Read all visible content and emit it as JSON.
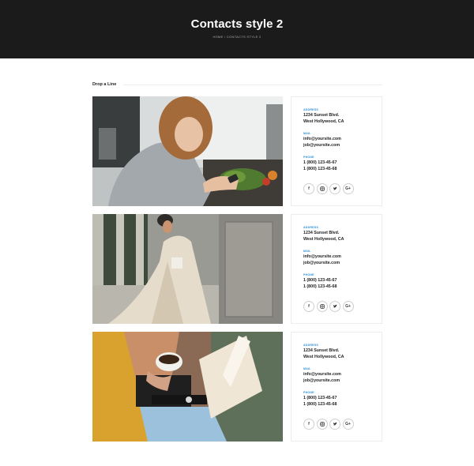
{
  "hero": {
    "title": "Contacts style 2",
    "breadcrumbs": [
      "Home",
      "/",
      "Contacts style 2"
    ]
  },
  "section": {
    "title": "Drop a Line"
  },
  "cards": [
    {
      "photo": "woman-smiling-at-phone-in-kitchen",
      "address_label": "Address",
      "address": [
        "1234 Sunset Blvd.",
        "West Hollywood, CA"
      ],
      "mail_label": "Mail",
      "mail": [
        "info@yoursite.com",
        "job@yoursite.com"
      ],
      "phone_label": "Phone",
      "phones": [
        "1 (800) 123-45-67",
        "1 (800) 123-45-68"
      ],
      "social": [
        "f",
        "instagram",
        "twitter",
        "G+"
      ]
    },
    {
      "photo": "woman-in-trench-coat-walking",
      "address_label": "Address",
      "address": [
        "1234 Sunset Blvd.",
        "West Hollywood, CA"
      ],
      "mail_label": "Mail",
      "mail": [
        "info@yoursite.com",
        "job@yoursite.com"
      ],
      "phone_label": "Phone",
      "phones": [
        "1 (800) 123-45-67",
        "1 (800) 123-45-68"
      ],
      "social": [
        "f",
        "instagram",
        "twitter",
        "G+"
      ]
    },
    {
      "photo": "woman-with-coffee-and-book",
      "address_label": "Address",
      "address": [
        "1234 Sunset Blvd.",
        "West Hollywood, CA"
      ],
      "mail_label": "Mail",
      "mail": [
        "info@yoursite.com",
        "job@yoursite.com"
      ],
      "phone_label": "Phone",
      "phones": [
        "1 (800) 123-45-67",
        "1 (800) 123-45-68"
      ],
      "social": [
        "f",
        "instagram",
        "twitter",
        "G+"
      ]
    }
  ],
  "colors": {
    "hero_bg": "#1b1b1b",
    "accent_label": "#2f8fd8"
  }
}
